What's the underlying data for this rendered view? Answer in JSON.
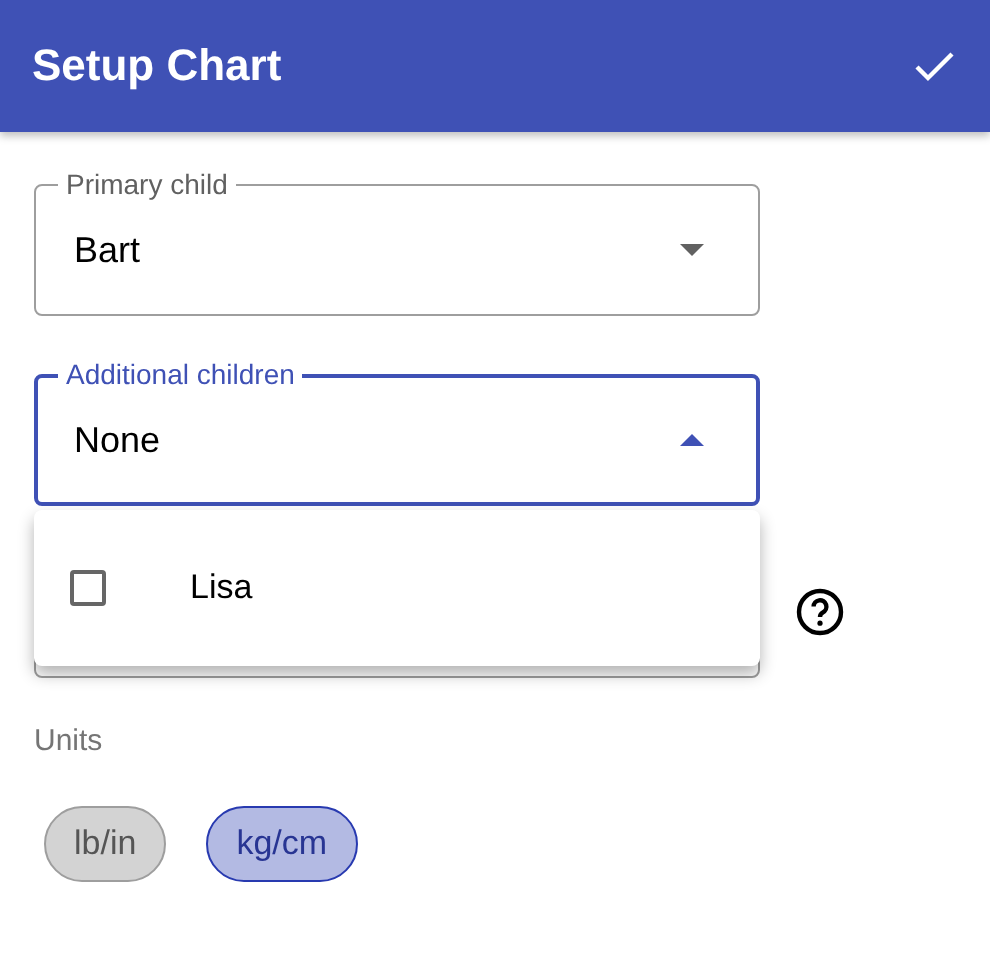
{
  "app_bar": {
    "title": "Setup Chart"
  },
  "fields": [
    {
      "label": "Primary child",
      "value": "Bart",
      "focused": false,
      "expanded": false
    },
    {
      "label": "Additional children",
      "value": "None",
      "focused": true,
      "expanded": true
    }
  ],
  "menu": {
    "items": [
      {
        "label": "Lisa",
        "checked": false
      }
    ]
  },
  "units": {
    "label": "Units",
    "chips": [
      {
        "label": "lb/in",
        "selected": false
      },
      {
        "label": "kg/cm",
        "selected": true
      }
    ]
  }
}
